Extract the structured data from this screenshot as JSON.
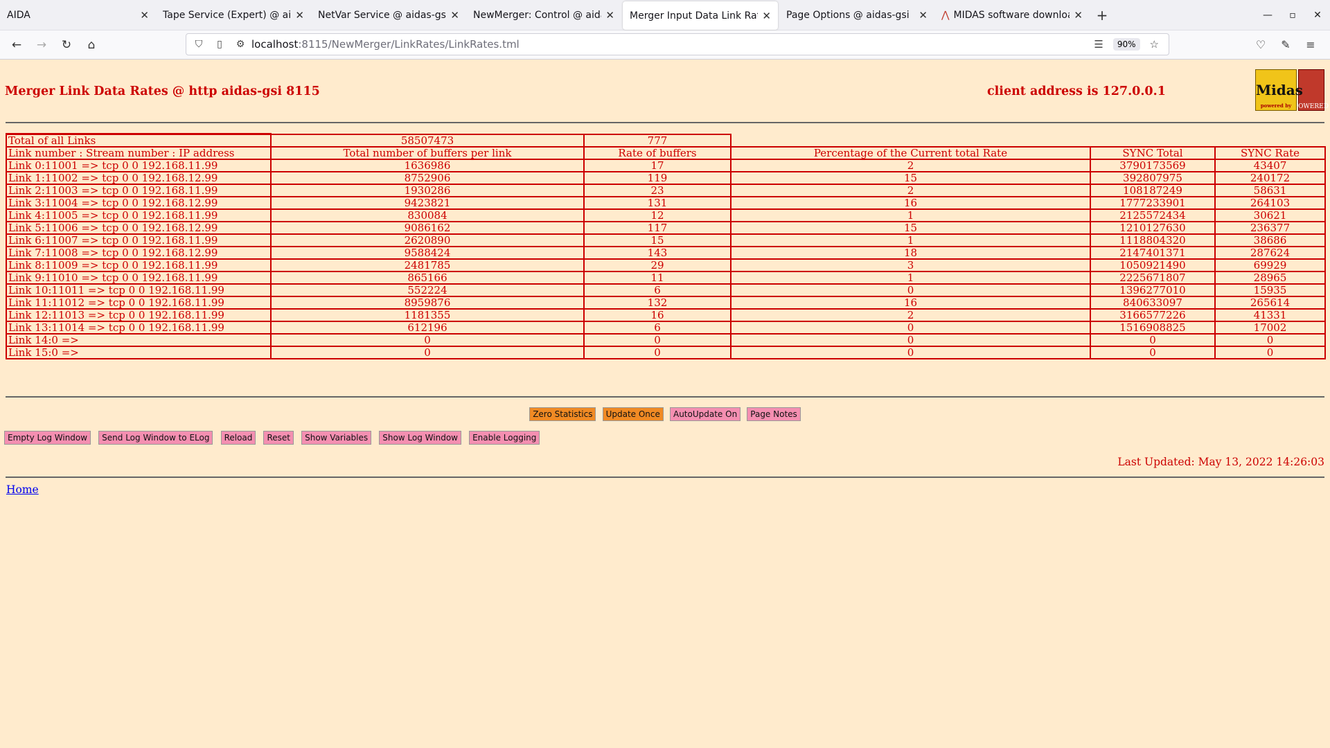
{
  "browser": {
    "tabs": [
      {
        "title": "AIDA",
        "active": false
      },
      {
        "title": "Tape Service (Expert) @ aidas-gsi",
        "active": false
      },
      {
        "title": "NetVar Service @ aidas-gsi",
        "active": false
      },
      {
        "title": "NewMerger: Control @ aidas-gsi",
        "active": false
      },
      {
        "title": "Merger Input Data Link Rates",
        "active": true
      },
      {
        "title": "Page Options @ aidas-gsi",
        "active": false
      },
      {
        "title": "MIDAS software download",
        "active": false
      }
    ],
    "url_host": "localhost",
    "url_rest": ":8115/NewMerger/LinkRates/LinkRates.tml",
    "zoom": "90%"
  },
  "page": {
    "title": "Merger Link Data Rates @ http aidas-gsi 8115",
    "client": "client address is 127.0.0.1",
    "logo_text": "Midas",
    "logo_sub": "powered by",
    "tcl_text": "POWERED",
    "totals": {
      "label": "Total of all Links",
      "buffers": "58507473",
      "rate": "777"
    },
    "headers": [
      "Link number : Stream number : IP address",
      "Total number of buffers per link",
      "Rate of buffers",
      "Percentage of the Current total Rate",
      "SYNC Total",
      "SYNC Rate"
    ],
    "rows": [
      [
        "Link 0:11001 => tcp 0 0 192.168.11.99",
        "1636986",
        "17",
        "2",
        "3790173569",
        "43407"
      ],
      [
        "Link 1:11002 => tcp 0 0 192.168.12.99",
        "8752906",
        "119",
        "15",
        "392807975",
        "240172"
      ],
      [
        "Link 2:11003 => tcp 0 0 192.168.11.99",
        "1930286",
        "23",
        "2",
        "108187249",
        "58631"
      ],
      [
        "Link 3:11004 => tcp 0 0 192.168.12.99",
        "9423821",
        "131",
        "16",
        "1777233901",
        "264103"
      ],
      [
        "Link 4:11005 => tcp 0 0 192.168.11.99",
        "830084",
        "12",
        "1",
        "2125572434",
        "30621"
      ],
      [
        "Link 5:11006 => tcp 0 0 192.168.12.99",
        "9086162",
        "117",
        "15",
        "1210127630",
        "236377"
      ],
      [
        "Link 6:11007 => tcp 0 0 192.168.11.99",
        "2620890",
        "15",
        "1",
        "1118804320",
        "38686"
      ],
      [
        "Link 7:11008 => tcp 0 0 192.168.12.99",
        "9588424",
        "143",
        "18",
        "2147401371",
        "287624"
      ],
      [
        "Link 8:11009 => tcp 0 0 192.168.11.99",
        "2481785",
        "29",
        "3",
        "1050921490",
        "69929"
      ],
      [
        "Link 9:11010 => tcp 0 0 192.168.11.99",
        "865166",
        "11",
        "1",
        "2225671807",
        "28965"
      ],
      [
        "Link 10:11011 => tcp 0 0 192.168.11.99",
        "552224",
        "6",
        "0",
        "1396277010",
        "15935"
      ],
      [
        "Link 11:11012 => tcp 0 0 192.168.11.99",
        "8959876",
        "132",
        "16",
        "840633097",
        "265614"
      ],
      [
        "Link 12:11013 => tcp 0 0 192.168.11.99",
        "1181355",
        "16",
        "2",
        "3166577226",
        "41331"
      ],
      [
        "Link 13:11014 => tcp 0 0 192.168.11.99",
        "612196",
        "6",
        "0",
        "1516908825",
        "17002"
      ],
      [
        "Link 14:0 =>",
        "0",
        "0",
        "0",
        "0",
        "0"
      ],
      [
        "Link 15:0 =>",
        "0",
        "0",
        "0",
        "0",
        "0"
      ]
    ],
    "controls": [
      "Zero Statistics",
      "Update Once",
      "AutoUpdate On",
      "Page Notes"
    ],
    "log_buttons": [
      "Empty Log Window",
      "Send Log Window to ELog",
      "Reload",
      "Reset",
      "Show Variables",
      "Show Log Window",
      "Enable Logging"
    ],
    "last_updated": "Last Updated: May 13, 2022 14:26:03",
    "home_link": "Home"
  }
}
